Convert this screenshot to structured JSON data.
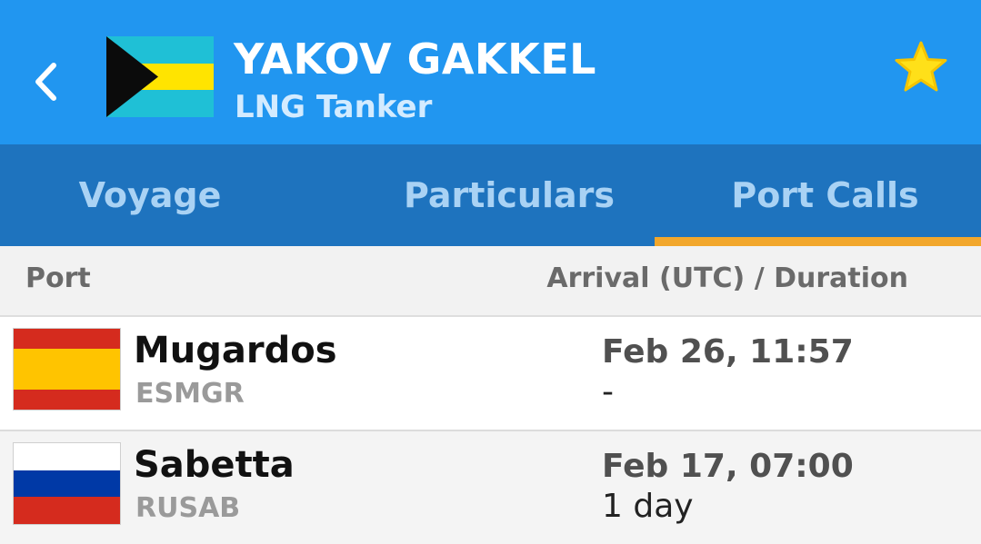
{
  "header": {
    "vessel_name": "YAKOV GAKKEL",
    "vessel_type": "LNG Tanker",
    "flag_icon": "bahamas-flag-icon",
    "colors": {
      "header_bg": "#2196f0",
      "star": "#ffd700"
    }
  },
  "tabs": [
    {
      "label": "Voyage"
    },
    {
      "label": "Particulars"
    },
    {
      "label": "Port Calls",
      "selected": true
    }
  ],
  "table": {
    "col_port": "Port",
    "col_arrival": "Arrival (UTC) / Duration",
    "rows": [
      {
        "port": "Mugardos",
        "code": "ESMGR",
        "arrival": "Feb 26, 11:57",
        "duration": "-",
        "flag_icon": "spain-flag-icon"
      },
      {
        "port": "Sabetta",
        "code": "RUSAB",
        "arrival": "Feb 17, 07:00",
        "duration": "1 day",
        "flag_icon": "russia-flag-icon"
      }
    ]
  }
}
